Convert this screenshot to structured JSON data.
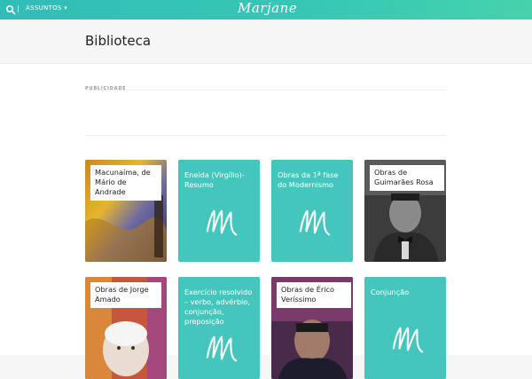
{
  "topbar": {
    "search_icon": "search-icon",
    "separator": "|",
    "subjects_label": "ASSUNTOS ▾",
    "logo": "Marjane"
  },
  "header": {
    "title": "Biblioteca"
  },
  "ad": {
    "label": "PUBLICIDADE"
  },
  "cards": [
    {
      "title": "Macunaíma, de Mário de Andrade",
      "style": "cover",
      "cover": "macunaima"
    },
    {
      "title": "Eneida (Virgílio)- Resumo",
      "style": "teal"
    },
    {
      "title": "Obras da 1ª fase do Modernismo",
      "style": "teal"
    },
    {
      "title": "Obras de Guimarães Rosa",
      "style": "cover",
      "cover": "guimaraes"
    },
    {
      "title": "Obras de Jorge Amado",
      "style": "cover",
      "cover": "jorge"
    },
    {
      "title": "Exercício resolvido – verbo, advérbio, conjunção, preposição",
      "style": "teal"
    },
    {
      "title": "Obras de Érico Veríssimo",
      "style": "cover",
      "cover": "erico"
    },
    {
      "title": "Conjunção",
      "style": "teal"
    }
  ],
  "colors": {
    "teal": "#45c6bd",
    "brand_gradient_start": "#31bdb7",
    "brand_gradient_end": "#45d3ac"
  }
}
